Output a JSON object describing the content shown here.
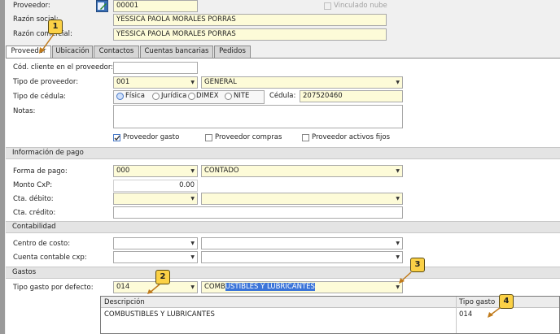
{
  "header": {
    "proveedor_label": "Proveedor:",
    "proveedor_code": "00001",
    "vinculado_label": "Vinculado nube",
    "razon_social_label": "Razón social:",
    "razon_social_value": "YESSICA PAOLA MORALES PORRAS",
    "razon_comercial_label": "Razón comercial:",
    "razon_comercial_value": "YESSICA  PAOLA MORALES PORRAS"
  },
  "tabs": [
    "Proveedor",
    "Ubicación",
    "Contactos",
    "Cuentas bancarias",
    "Pedidos"
  ],
  "proveedor": {
    "cod_cliente_label": "Cód. cliente en el proveedor:",
    "tipo_proveedor_label": "Tipo de proveedor:",
    "tipo_proveedor_code": "001",
    "tipo_proveedor_desc": "GENERAL",
    "tipo_cedula_label": "Tipo de cédula:",
    "cedula_options": [
      "Física",
      "Jurídica",
      "DIMEX",
      "NITE"
    ],
    "cedula_label": "Cédula:",
    "cedula_value": "207520460",
    "notas_label": "Notas:",
    "check_gasto": "Proveedor gasto",
    "check_compras": "Proveedor compras",
    "check_activos": "Proveedor activos fijos"
  },
  "pago": {
    "section_title": "Información de pago",
    "forma_pago_label": "Forma de pago:",
    "forma_pago_code": "000",
    "forma_pago_desc": "CONTADO",
    "monto_label": "Monto CxP:",
    "monto_value": "0.00",
    "cta_debito_label": "Cta. débito:",
    "cta_credito_label": "Cta. crédito:"
  },
  "contabilidad": {
    "section_title": "Contabilidad",
    "centro_costo_label": "Centro de costo:",
    "cuenta_cxp_label": "Cuenta contable cxp:"
  },
  "gastos": {
    "section_title": "Gastos",
    "tipo_gasto_label": "Tipo gasto por defecto:",
    "tipo_gasto_code": "014",
    "tipo_gasto_desc_plain": "COMB",
    "tipo_gasto_desc_selected": "USTIBLES Y LUBRICANTES",
    "list_header_desc": "Descripción",
    "list_header_tipo": "Tipo gasto",
    "list_row_desc": "COMBUSTIBLES Y LUBRICANTES",
    "list_row_tipo": "014"
  },
  "callouts": [
    "1",
    "2",
    "3",
    "4"
  ]
}
